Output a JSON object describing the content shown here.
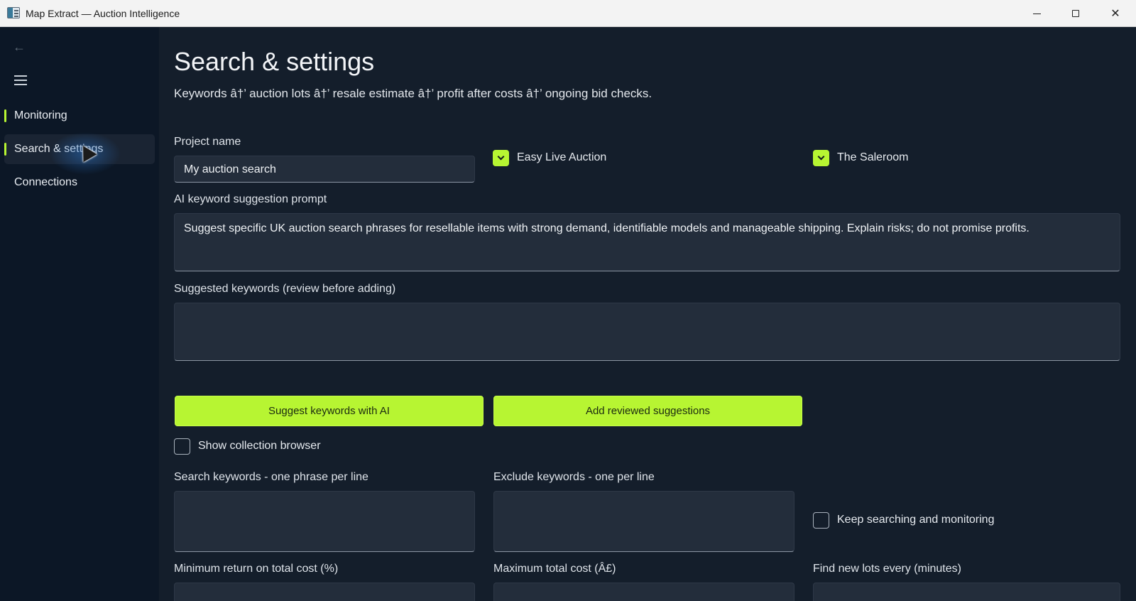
{
  "window": {
    "title": "Map Extract — Auction Intelligence"
  },
  "sidebar": {
    "items": [
      {
        "label": "Monitoring"
      },
      {
        "label": "Search & settings"
      },
      {
        "label": "Connections"
      }
    ],
    "selected": "Search & settings"
  },
  "page": {
    "title": "Search & settings",
    "subtitle": "Keywords â†’ auction lots â†’ resale estimate â†’ profit after costs â†’ ongoing bid checks."
  },
  "form": {
    "project_name_label": "Project name",
    "project_name_value": "My auction search",
    "sources": [
      {
        "label": "Easy Live Auction",
        "checked": true
      },
      {
        "label": "The Saleroom",
        "checked": true
      }
    ],
    "ai_prompt_label": "AI keyword suggestion prompt",
    "ai_prompt_value": "Suggest specific UK auction search phrases for resellable items with strong demand, identifiable models and manageable shipping. Explain risks; do not promise profits.",
    "suggested_label": "Suggested keywords (review before adding)",
    "suggested_value": "",
    "suggest_button": "Suggest keywords with AI",
    "add_button": "Add reviewed suggestions",
    "show_browser_label": "Show collection browser",
    "show_browser_checked": false,
    "search_keywords_label": "Search keywords - one phrase per line",
    "search_keywords_value": "",
    "exclude_keywords_label": "Exclude keywords - one per line",
    "exclude_keywords_value": "",
    "keep_searching_label": "Keep searching and monitoring",
    "keep_searching_checked": false,
    "min_return_label": "Minimum return on total cost (%)",
    "max_cost_label": "Maximum total cost (Â£)",
    "find_every_label": "Find new lots every (minutes)"
  },
  "colors": {
    "accent": "#b7f532",
    "sidebar_bg": "#0c1726",
    "main_bg": "#141e2b",
    "field_bg": "#232d3b"
  }
}
